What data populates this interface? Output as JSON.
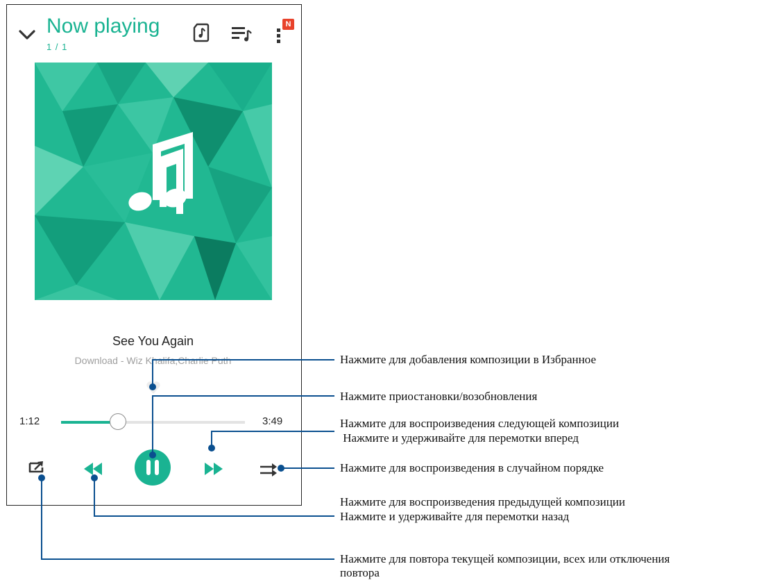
{
  "header": {
    "title": "Now playing",
    "counter": "1 / 1",
    "more_badge": "N"
  },
  "track": {
    "title": "See You Again",
    "artist": "Download - Wiz Khalifa,Charlie Puth"
  },
  "progress": {
    "current": "1:12",
    "total": "3:49",
    "fraction": 0.31
  },
  "colors": {
    "accent": "#1ab392",
    "callout_line": "#0a4f8f",
    "badge": "#e8422b"
  },
  "icons": {
    "collapse": "chevron-down-icon",
    "lyrics": "lyrics-icon",
    "queue": "queue-icon",
    "more": "more-vertical-icon",
    "favorite": "heart-icon",
    "repeat": "repeat-icon",
    "previous": "rewind-icon",
    "play_pause": "pause-icon",
    "next": "fast-forward-icon",
    "shuffle": "shuffle-icon"
  },
  "annotations": {
    "favorite": "Нажмите для добавления композиции в Избранное",
    "pause": "Нажмите приостановки/возобновления",
    "next_1": "Нажмите для воспроизведения следующей композиции",
    "next_2": " Нажмите и удерживайте для перемотки вперед",
    "shuffle": "Нажмите для воспроизведения в случайном порядке",
    "prev_1": "Нажмите для воспроизведения предыдущей композиции",
    "prev_2": "Нажмите и удерживайте для перемотки назад",
    "repeat_1": "Нажмите для повтора текущей композиции, всех или отключения",
    "repeat_2": "повтора"
  }
}
